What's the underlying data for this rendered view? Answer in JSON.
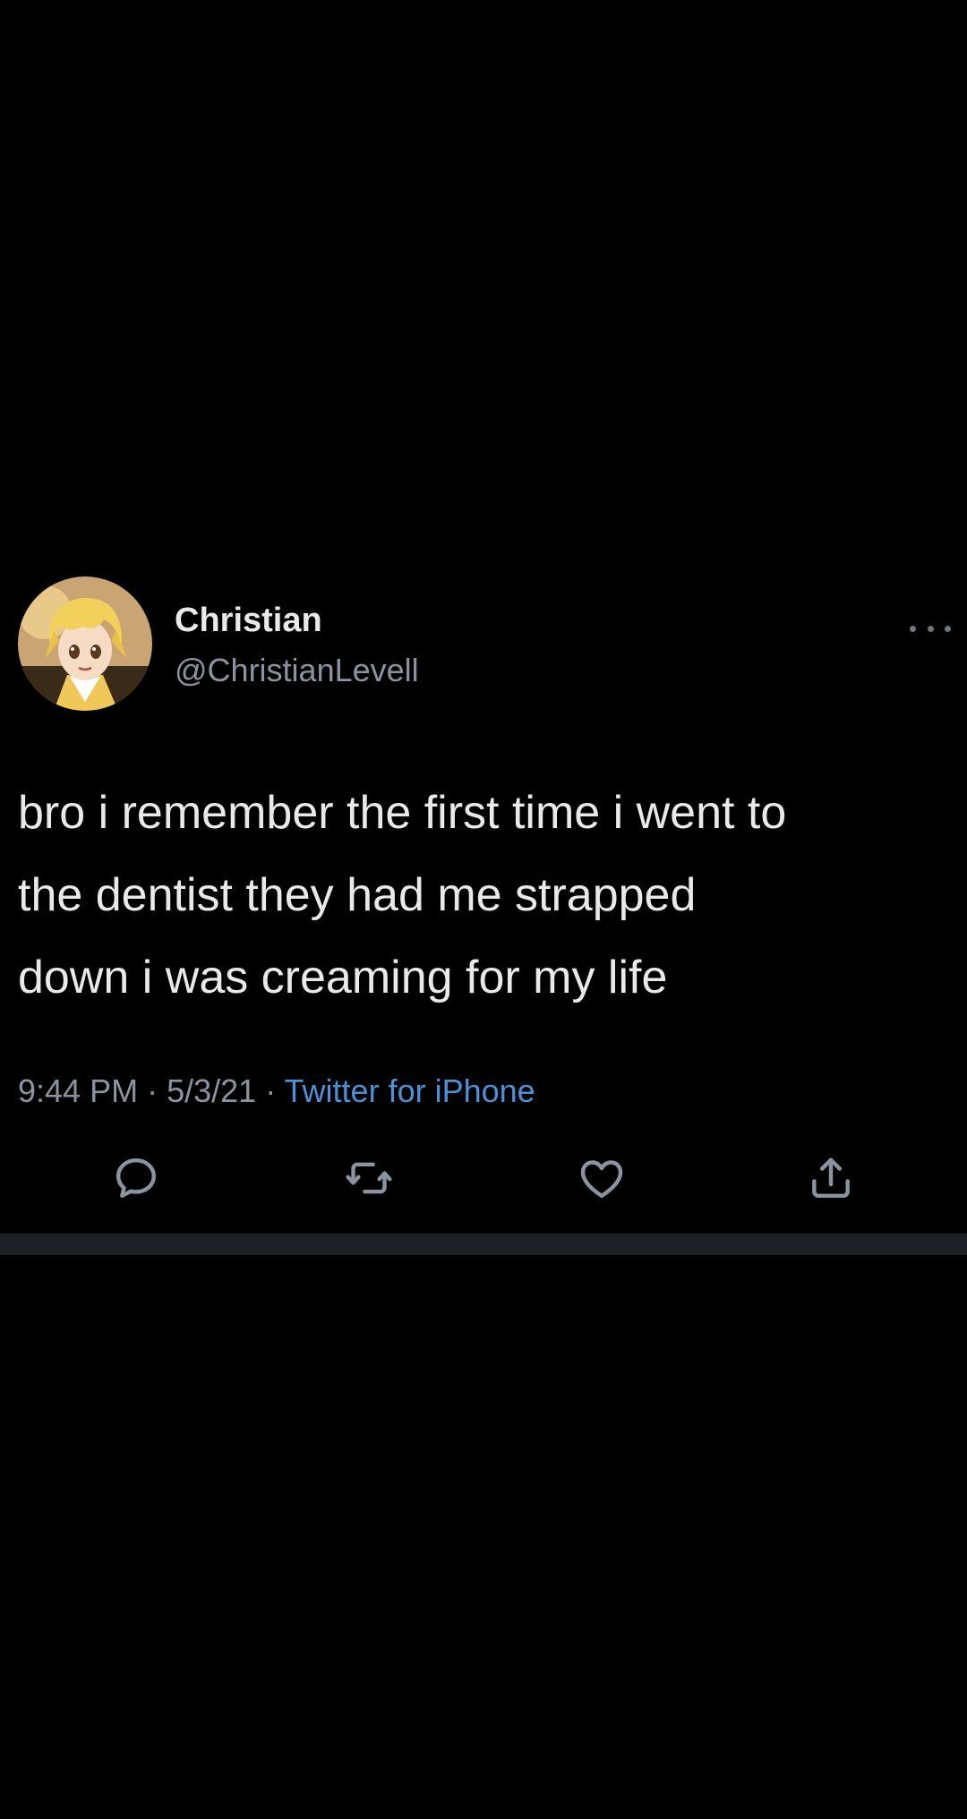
{
  "tweet": {
    "display_name": "Christian",
    "handle": "@ChristianLevell",
    "text_lines": [
      "bro i remember the first time i went to",
      "the dentist they had me strapped",
      "down i was creaming for my life"
    ],
    "time": "9:44 PM",
    "separator": "·",
    "date": "5/3/21",
    "source": "Twitter for iPhone"
  },
  "icons": {
    "avatar": "avatar-image",
    "more": "more-dots-icon",
    "reply": "reply-icon",
    "retweet": "retweet-icon",
    "like": "heart-icon",
    "share": "share-icon"
  },
  "colors": {
    "background": "#000000",
    "primary_text": "#e7e9ea",
    "secondary_text": "#8b949e",
    "link": "#4f8fd6",
    "icon": "#8b949e",
    "divider": "#1c2226"
  }
}
